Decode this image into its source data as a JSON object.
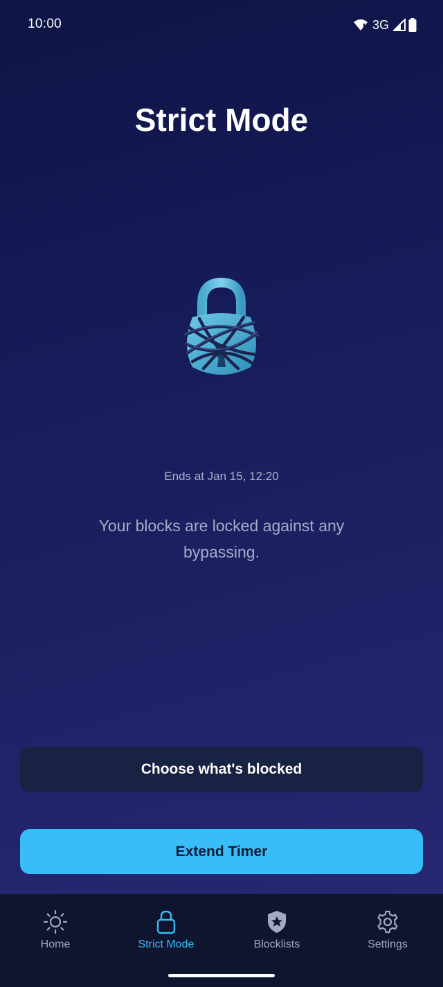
{
  "status_bar": {
    "time": "10:00",
    "network": "3G",
    "icons": [
      "wifi-icon",
      "signal-icon",
      "battery-icon"
    ]
  },
  "page": {
    "title": "Strict Mode",
    "illustration": "padlock-tied-with-rope",
    "ends_at": "Ends at Jan 15, 12:20",
    "description": "Your blocks are locked against any bypassing."
  },
  "actions": {
    "choose_label": "Choose what's blocked",
    "extend_label": "Extend Timer"
  },
  "nav": {
    "items": [
      {
        "label": "Home",
        "icon": "sun-icon",
        "active": false
      },
      {
        "label": "Strict Mode",
        "icon": "lock-icon",
        "active": true
      },
      {
        "label": "Blocklists",
        "icon": "shield-star-icon",
        "active": false
      },
      {
        "label": "Settings",
        "icon": "gear-icon",
        "active": false
      }
    ]
  },
  "colors": {
    "accent": "#38bdf8",
    "background_top": "#0e1445",
    "background_bottom": "#282a76",
    "secondary_button": "#182242",
    "nav_background": "#0f152f",
    "nav_inactive": "#a2a9c2"
  }
}
